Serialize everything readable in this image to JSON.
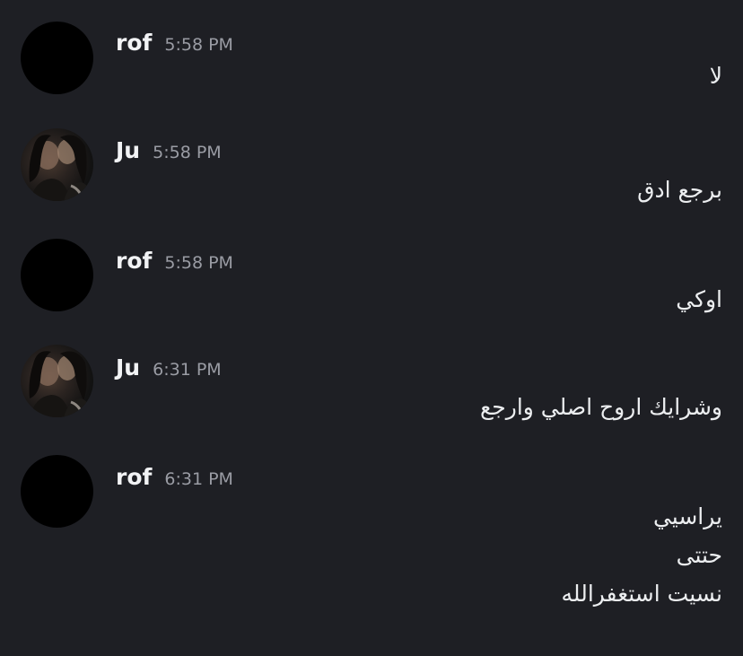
{
  "messages": [
    {
      "author": "rof",
      "time": "5:58 PM",
      "avatar": "black-circle",
      "lines": [
        "لا"
      ]
    },
    {
      "author": "Ju",
      "time": "5:58 PM",
      "avatar": "photo-two-people",
      "lines": [
        "برجع ادق"
      ]
    },
    {
      "author": "rof",
      "time": "5:58 PM",
      "avatar": "black-circle",
      "lines": [
        "اوكي"
      ]
    },
    {
      "author": "Ju",
      "time": "6:31 PM",
      "avatar": "photo-two-people",
      "lines": [
        "وشرايك اروح اصلي وارجع"
      ]
    },
    {
      "author": "rof",
      "time": "6:31 PM",
      "avatar": "black-circle",
      "lines": [
        "يراسيي",
        "حتتى",
        "نسيت استغفرالله"
      ]
    }
  ],
  "colors": {
    "background": "#1e1f24",
    "author": "#f2f3f5",
    "timestamp": "#9a9ca4",
    "message_text": "#eceef0",
    "avatar_blank": "#000000"
  }
}
